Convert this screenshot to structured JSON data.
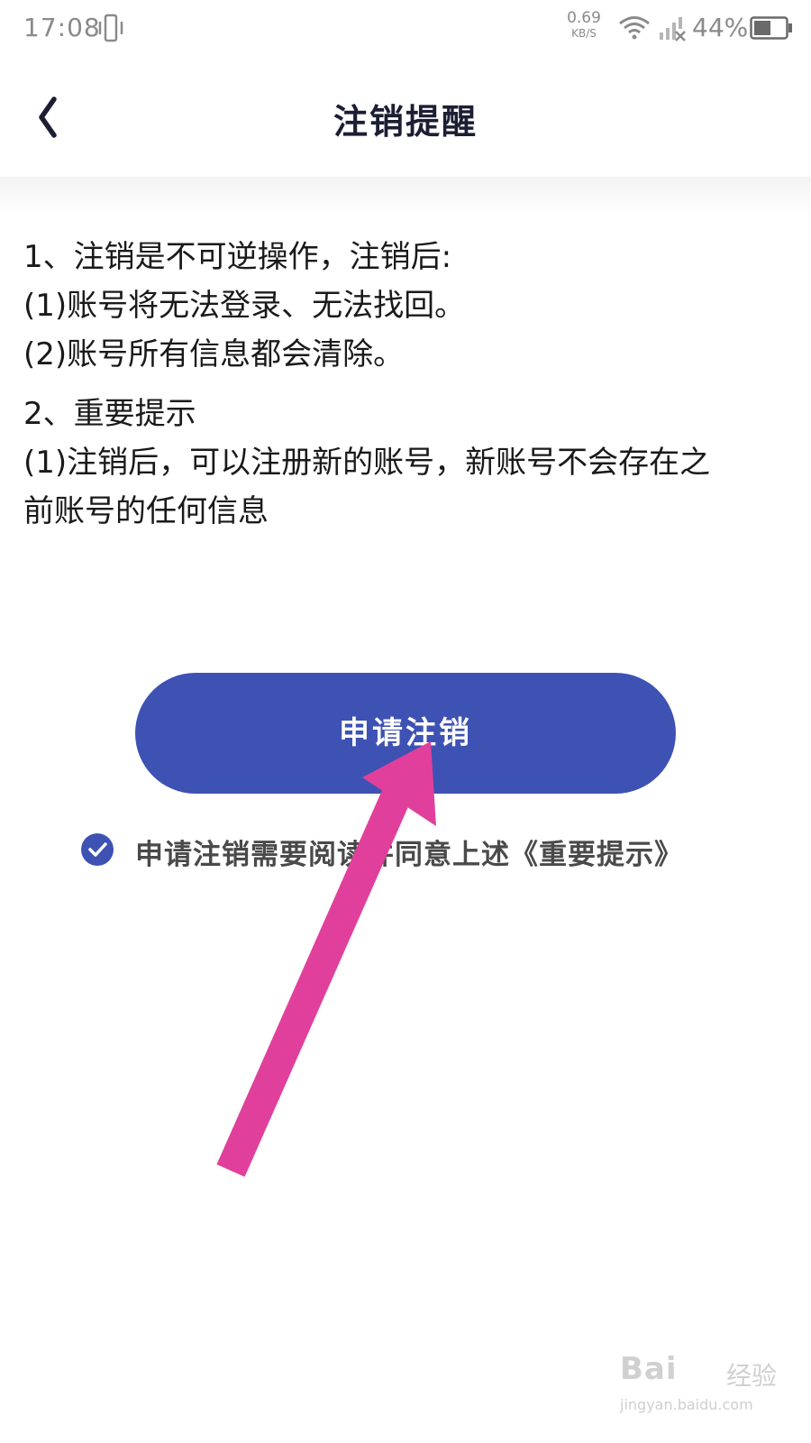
{
  "status_bar": {
    "time": "17:08",
    "net_speed_value": "0.69",
    "net_speed_unit": "KB/S",
    "battery": "44%",
    "icons": [
      "vibrate-icon",
      "wifi-icon",
      "signal-icon",
      "battery-icon"
    ]
  },
  "header": {
    "title": "注销提醒",
    "back_icon": "chevron-left-icon"
  },
  "notice": {
    "lines": [
      "1、注销是不可逆操作，注销后:",
      "(1)账号将无法登录、无法找回。",
      "(2)账号所有信息都会清除。",
      "2、重要提示",
      "(1)注销后，可以注册新的账号，新账号不会存在之",
      "前账号的任何信息"
    ]
  },
  "actions": {
    "apply_label": "申请注销"
  },
  "agreement": {
    "checked": true,
    "text": "申请注销需要阅读并同意上述《重要提示》"
  },
  "watermark": {
    "brand": "Bai",
    "brand2": "经验",
    "url": "jingyan.baidu.com"
  },
  "colors": {
    "accent": "#3d52b3",
    "arrow": "#e0409c",
    "title": "#1c1e33"
  }
}
